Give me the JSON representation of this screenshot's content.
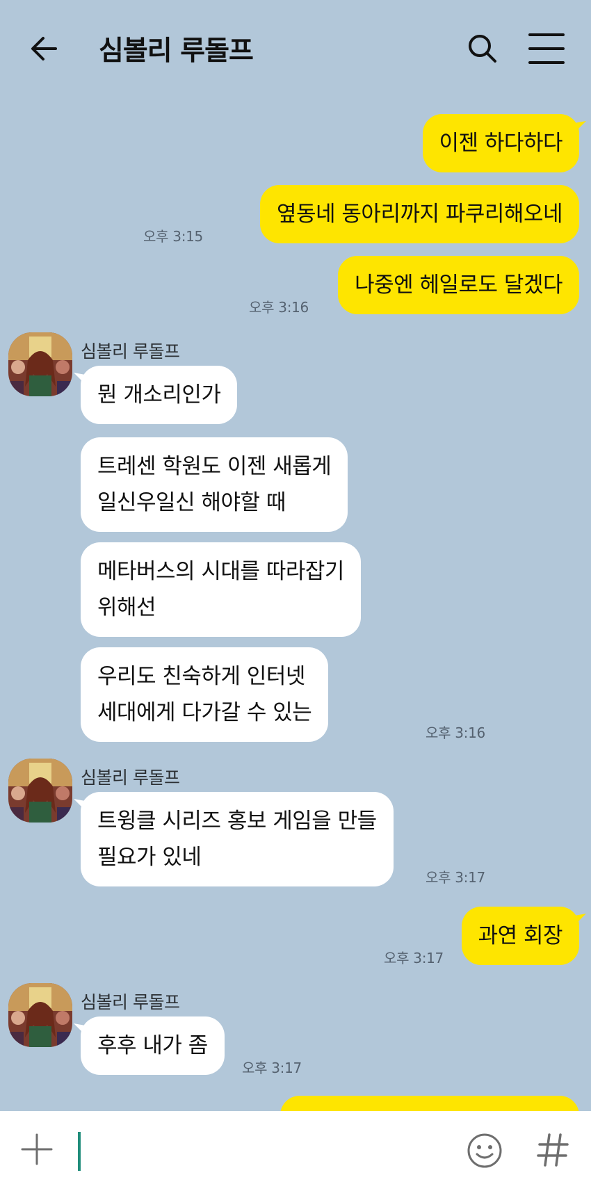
{
  "header": {
    "title": "심볼리 루돌프",
    "back_icon": "arrow-left-icon",
    "search_icon": "search-icon",
    "menu_icon": "hamburger-menu-icon"
  },
  "messages": [
    {
      "from": "me",
      "text": "이젠 하다하다"
    },
    {
      "from": "me",
      "text": "옆동네 동아리까지 파쿠리해오네",
      "time": "오후 3:15"
    },
    {
      "from": "me",
      "text": "나중엔 헤일로도 달겠다",
      "time": "오후 3:16"
    },
    {
      "from": "other",
      "sender": "심볼리 루돌프",
      "text": "뭔 개소리인가"
    },
    {
      "from": "other",
      "lines": [
        "트레센 학원도 이젠 새롭게",
        "일신우일신 해야할 때"
      ]
    },
    {
      "from": "other",
      "lines": [
        "메타버스의 시대를 따라잡기",
        "위해선"
      ]
    },
    {
      "from": "other",
      "lines": [
        "우리도 친숙하게 인터넷",
        "세대에게 다가갈 수 있는"
      ],
      "time": "오후 3:16"
    },
    {
      "from": "other",
      "sender": "심볼리 루돌프",
      "lines": [
        "트윙클 시리즈 홍보 게임을 만들",
        "필요가 있네"
      ],
      "time": "오후 3:17"
    },
    {
      "from": "me",
      "text": "과연 회장",
      "time": "오후 3:17"
    },
    {
      "from": "other",
      "sender": "심볼리 루돌프",
      "text": "후후 내가 좀",
      "time": "오후 3:17"
    }
  ],
  "input": {
    "plus_icon": "plus-icon",
    "emoji_icon": "emoji-icon",
    "hash_icon": "hash-icon",
    "value": ""
  },
  "colors": {
    "background": "#b2c7d9",
    "my_bubble": "#fee500",
    "other_bubble": "#ffffff",
    "caret": "#1f8c7a"
  }
}
